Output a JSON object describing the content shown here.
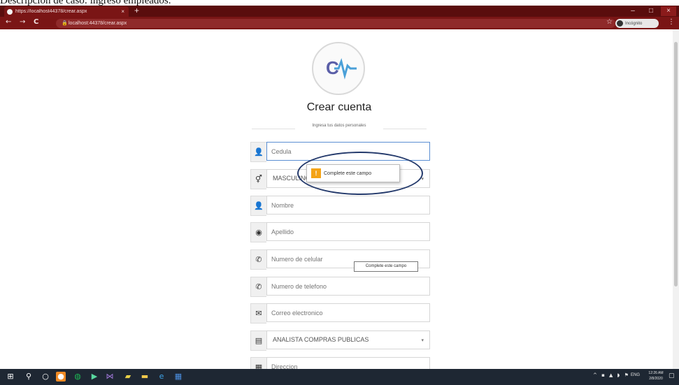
{
  "document": {
    "caption": "Descripción de caso: ingreso empleados."
  },
  "browser": {
    "tab_title": "https://localhost44378/crear.aspx",
    "tab_close": "×",
    "new_tab": "+",
    "url": "localhost:44378/crear.aspx",
    "profile_label": "Incógnito",
    "win_min": "–",
    "win_max": "□",
    "win_close": "×",
    "icons": {
      "back": "←",
      "forward": "→",
      "reload": "C",
      "lock": "🔒",
      "star": "☆",
      "menu": "⋮"
    }
  },
  "form": {
    "title": "Crear cuenta",
    "subtitle": "Ingresa tus datos personales",
    "fields": [
      {
        "name": "cedula",
        "icon": "👤",
        "placeholder": "Cedula",
        "type": "input"
      },
      {
        "name": "sexo",
        "icon": "⚥",
        "value": "MASCULINO",
        "type": "select"
      },
      {
        "name": "nombre",
        "icon": "👤",
        "placeholder": "Nombre",
        "type": "input"
      },
      {
        "name": "apellido",
        "icon": "◉",
        "placeholder": "Apellido",
        "type": "input"
      },
      {
        "name": "celular",
        "icon": "✆",
        "placeholder": "Numero de celular",
        "type": "input"
      },
      {
        "name": "telefono",
        "icon": "✆",
        "placeholder": "Numero de telefono",
        "type": "input"
      },
      {
        "name": "correo",
        "icon": "✉",
        "placeholder": "Correo electronico",
        "type": "input"
      },
      {
        "name": "cargo",
        "icon": "▤",
        "value": "ANALISTA COMPRAS PUBLICAS",
        "type": "select"
      },
      {
        "name": "direccion",
        "icon": "▦",
        "placeholder": "Direccion",
        "type": "input"
      }
    ],
    "caret": "▾"
  },
  "validation": {
    "tooltip_main": "Complete este campo",
    "tooltip_icon": "!",
    "tooltip_small": "Complete este campo"
  },
  "taskbar": {
    "icons": [
      "⊞",
      "⚲",
      "○",
      "●",
      "◍",
      "▶",
      "⋈",
      "▰",
      "▬",
      "e",
      "▦"
    ],
    "tray_icons": "^ ▪ ▲ ◗ ⚑",
    "lang": "ENG",
    "time": "12:26 AM",
    "date": "2/8/2020",
    "notif": "▢"
  }
}
